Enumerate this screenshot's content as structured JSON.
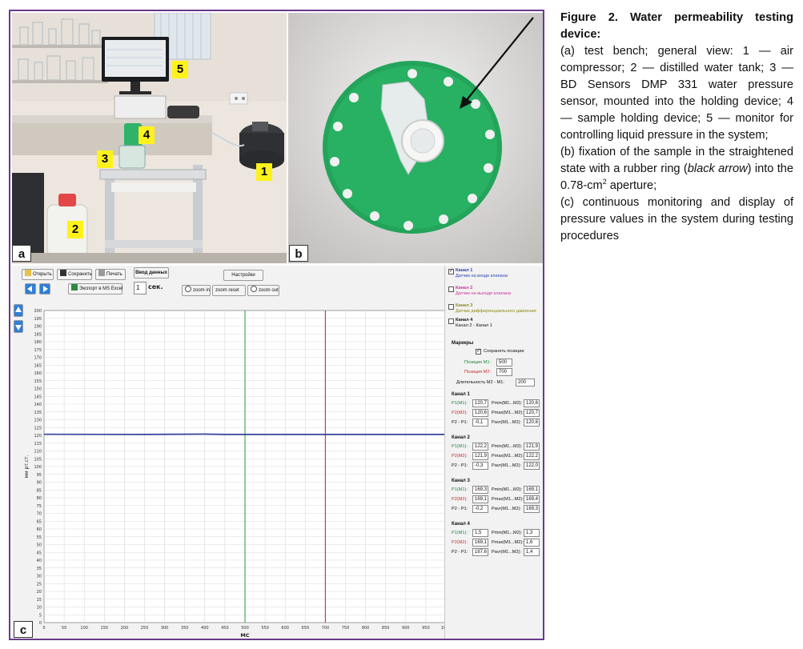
{
  "figure": {
    "panel_letters": {
      "a": "a",
      "b": "b",
      "c": "c"
    },
    "photo_a_labels": [
      "1",
      "2",
      "3",
      "4",
      "5"
    ]
  },
  "caption": {
    "title": "Figure 2. Water permeability testing device:",
    "item_a": "(a) test bench; general view: 1 — air compressor; 2 — distilled water tank; 3 — BD Sensors DMP 331 water pressure sensor, mounted into the holding device; 4 — sample holding device; 5 — monitor for controlling liquid pressure in the system;",
    "item_b_part1": "(b) fixation of the sample in the straightened state with a rubber ring (",
    "item_b_italic": "black arrow",
    "item_b_part2": ") into the 0.78-cm",
    "item_b_sup": "2",
    "item_b_part3": " aperture;",
    "item_c": "(c) continuous monitoring and display of pressure values in the system during testing procedures"
  },
  "software": {
    "toolbar": {
      "open": "Открыть",
      "save": "Сохранить",
      "print": "Печать",
      "export": "Экспорт в MS Excel",
      "data_input": "Ввод данных",
      "interval_value": "1",
      "interval_unit": "сек.",
      "settings": "Настройки",
      "zoom_in": "zoom in",
      "zoom_reset": "zoom reset",
      "zoom_out": "zoom out"
    },
    "channels": [
      {
        "name": "Канал 1",
        "desc": "Датчик на входе клапана",
        "checked": true,
        "color": "#2a3fb0"
      },
      {
        "name": "Канал 2",
        "desc": "Датчик на выходе клапана",
        "checked": false,
        "color": "#d0309a"
      },
      {
        "name": "Канал 3",
        "desc": "Датчик дифференциального давления",
        "checked": false,
        "color": "#8a8a10"
      },
      {
        "name": "Канал 4",
        "desc": "Канал 2 - Канал 1",
        "checked": false,
        "color": "#111111"
      }
    ],
    "markers": {
      "title": "Маркеры",
      "save_positions": "Сохранять позиции",
      "m1_label": "Позиция М1:",
      "m1_value": "500",
      "m2_label": "Позиция М2:",
      "m2_value": "700",
      "duration_label": "Длительность М2 - М1:",
      "duration_value": "200"
    },
    "readouts": [
      {
        "title": "Канал 1",
        "p1": "120,7",
        "p2": "120,6",
        "dp": "-0,1",
        "pmin": "120,6",
        "pmax": "120,7",
        "pavg": "120,6"
      },
      {
        "title": "Канал 2",
        "p1": "122,2",
        "p2": "121,9",
        "dp": "-0,3",
        "pmin": "121,9",
        "pmax": "122,2",
        "pavg": "122,0"
      },
      {
        "title": "Канал 3",
        "p1": "169,3",
        "p2": "169,1",
        "dp": "-0,2",
        "pmin": "169,1",
        "pmax": "169,4",
        "pavg": "169,3"
      },
      {
        "title": "Канал 4",
        "p1": "1,5",
        "p2": "169,1",
        "dp": "167,6",
        "pmin": "1,3",
        "pmax": "1,6",
        "pavg": "1,4"
      }
    ],
    "readout_labels": {
      "p1": "P1(M1):",
      "p2": "P2(M2):",
      "dp": "P2 - P1:",
      "pmin": "Pmin(M1...M2):",
      "pmax": "Pmax(M1...M2):",
      "pavg": "Pavr(M1...M2):"
    }
  },
  "chart_data": {
    "type": "line",
    "xlabel": "МС",
    "ylabel": "мм рт.ст.",
    "xlim": [
      0,
      1000
    ],
    "ylim": [
      0,
      200
    ],
    "x_ticks": [
      0,
      50,
      100,
      150,
      200,
      250,
      300,
      350,
      400,
      450,
      500,
      550,
      600,
      650,
      700,
      750,
      800,
      850,
      900,
      950,
      1000
    ],
    "y_tick_step": 5,
    "grid": true,
    "series": [
      {
        "color": "#2b3a9a",
        "x": [
          0,
          250,
          400,
          450,
          1000
        ],
        "y": [
          120.7,
          120.6,
          120.8,
          120.6,
          120.6
        ]
      }
    ],
    "markers": [
      {
        "x": 500,
        "color": "#3aa24a"
      },
      {
        "x": 700,
        "color": "#d82a2a"
      }
    ]
  }
}
